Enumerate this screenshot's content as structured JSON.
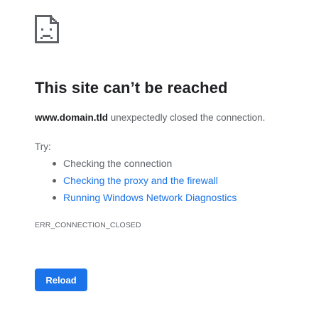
{
  "error_page": {
    "icon": "sad-page-icon",
    "title": "This site can’t be reached",
    "domain": "www.domain.tld",
    "message": "unexpectedly closed the connection.",
    "try_label": "Try:",
    "suggestions": [
      {
        "label": "Checking the connection",
        "link": false
      },
      {
        "label": "Checking the proxy and the firewall",
        "link": true
      },
      {
        "label": "Running Windows Network Diagnostics",
        "link": true
      }
    ],
    "error_code": "ERR_CONNECTION_CLOSED",
    "reload_label": "Reload"
  },
  "colors": {
    "accent": "#1a73e8",
    "title_text": "#202124",
    "secondary_text": "#5f6368",
    "background": "#ffffff"
  }
}
